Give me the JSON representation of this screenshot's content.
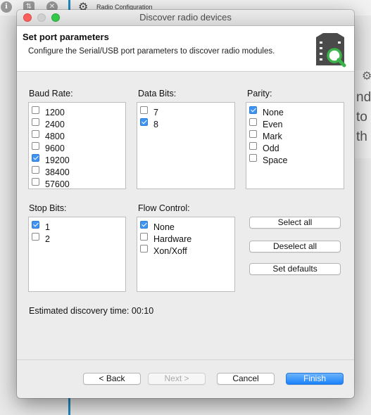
{
  "background": {
    "toolbar_title": "Radio Configuration",
    "right_text_lines": [
      "nd",
      "to",
      "th"
    ]
  },
  "dialog": {
    "title": "Discover radio devices",
    "header": {
      "title": "Set port parameters",
      "description": "Configure the Serial/USB port parameters to discover radio modules."
    },
    "baud_rate": {
      "label": "Baud Rate:",
      "items": [
        {
          "label": "1200",
          "checked": false
        },
        {
          "label": "2400",
          "checked": false
        },
        {
          "label": "4800",
          "checked": false
        },
        {
          "label": "9600",
          "checked": false
        },
        {
          "label": "19200",
          "checked": true
        },
        {
          "label": "38400",
          "checked": false
        },
        {
          "label": "57600",
          "checked": false
        }
      ]
    },
    "data_bits": {
      "label": "Data Bits:",
      "items": [
        {
          "label": "7",
          "checked": false
        },
        {
          "label": "8",
          "checked": true
        }
      ]
    },
    "parity": {
      "label": "Parity:",
      "items": [
        {
          "label": "None",
          "checked": true
        },
        {
          "label": "Even",
          "checked": false
        },
        {
          "label": "Mark",
          "checked": false
        },
        {
          "label": "Odd",
          "checked": false
        },
        {
          "label": "Space",
          "checked": false
        }
      ]
    },
    "stop_bits": {
      "label": "Stop Bits:",
      "items": [
        {
          "label": "1",
          "checked": true
        },
        {
          "label": "2",
          "checked": false
        }
      ]
    },
    "flow_control": {
      "label": "Flow Control:",
      "items": [
        {
          "label": "None",
          "checked": true
        },
        {
          "label": "Hardware",
          "checked": false
        },
        {
          "label": "Xon/Xoff",
          "checked": false
        }
      ]
    },
    "actions": {
      "select_all": "Select all",
      "deselect_all": "Deselect all",
      "set_defaults": "Set defaults"
    },
    "estimated": "Estimated discovery time: 00:10",
    "footer": {
      "back": "< Back",
      "next": "Next >",
      "cancel": "Cancel",
      "finish": "Finish"
    },
    "colors": {
      "checkbox_on": "#3f93f1",
      "primary_button": "#1a82fb",
      "close_light": "#fc605c",
      "max_light": "#34c84a"
    }
  }
}
